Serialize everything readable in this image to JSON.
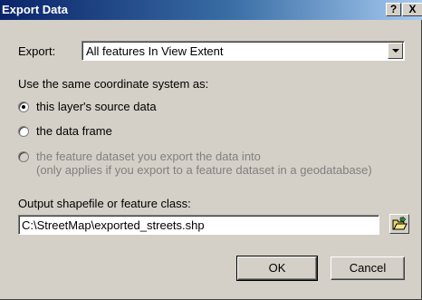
{
  "window": {
    "title": "Export Data",
    "help_label": "?",
    "close_label": "X"
  },
  "export": {
    "label": "Export:",
    "selected": "All features In View Extent"
  },
  "coordinate": {
    "heading": "Use the same coordinate system as:",
    "options": [
      {
        "label": "this layer's source data",
        "checked": true,
        "enabled": true
      },
      {
        "label": "the data frame",
        "checked": false,
        "enabled": true
      },
      {
        "label": "the feature dataset you export the data into",
        "note": "(only applies if you export to a feature dataset in a geodatabase)",
        "checked": false,
        "enabled": false
      }
    ]
  },
  "output": {
    "label": "Output shapefile or feature class:",
    "value": "C:\\StreetMap\\exported_streets.shp"
  },
  "buttons": {
    "ok": "OK",
    "cancel": "Cancel"
  },
  "colors": {
    "titlebar_start": "#0a246a",
    "titlebar_end": "#a6caf0",
    "face": "#d4d0c8"
  }
}
